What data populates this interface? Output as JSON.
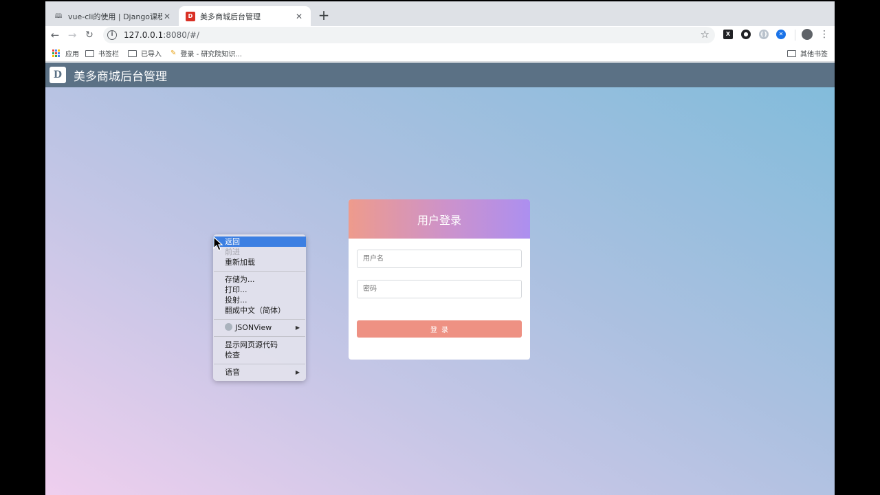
{
  "tabs": [
    {
      "title": "vue-cli的使用 | Django课程讲义",
      "active": false
    },
    {
      "title": "美多商城后台管理",
      "active": true
    }
  ],
  "toolbar": {
    "url_host": "127.0.0.1",
    "url_rest": ":8080/#/"
  },
  "bookmarks": {
    "apps": "应用",
    "items": [
      "书签栏",
      "已导入",
      "登录 - 研究院知识..."
    ],
    "other": "其他书签"
  },
  "app": {
    "logo": "D",
    "title": "美多商城后台管理"
  },
  "login": {
    "heading": "用户登录",
    "username_placeholder": "用户名",
    "password_placeholder": "密码",
    "submit_label": "登录"
  },
  "context_menu": {
    "group1": [
      {
        "label": "返回",
        "state": "highlighted"
      },
      {
        "label": "前进",
        "state": "disabled"
      },
      {
        "label": "重新加载",
        "state": "normal"
      }
    ],
    "group2": [
      "存储为...",
      "打印...",
      "投射...",
      "翻成中文（简体）"
    ],
    "group3": [
      {
        "label": "JSONView",
        "submenu": true
      }
    ],
    "group4": [
      "显示网页源代码",
      "检查"
    ],
    "group5": [
      {
        "label": "语音",
        "submenu": true
      }
    ]
  },
  "colors": {
    "header_bg": "#5b7185",
    "login_gradient_start": "#ee9b8c",
    "login_gradient_end": "#ac8ff0",
    "login_button": "#ee9183",
    "menu_highlight": "#3c7fe2"
  }
}
